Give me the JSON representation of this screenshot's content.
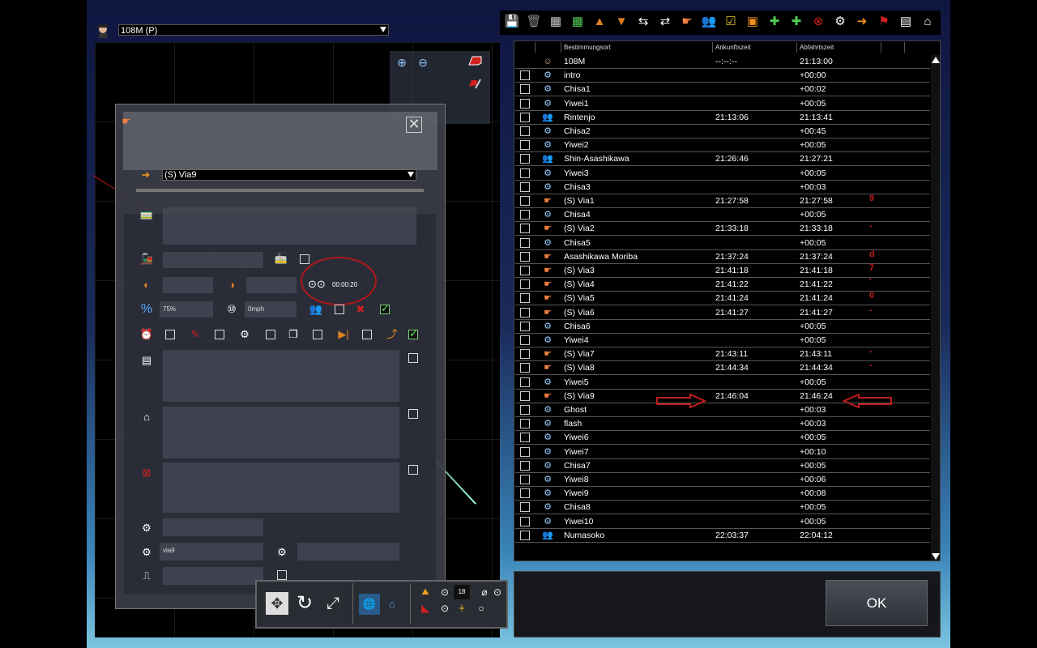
{
  "top": {
    "route_value": "108M (P)"
  },
  "panel": {
    "waypoint_value": "(S) Via9",
    "duration_value": "00:00:20",
    "percent_value": "75%",
    "speed_value": "0mph",
    "name_value": "via9"
  },
  "table": {
    "headers": {
      "destination": "Bestimmungsort",
      "arrival": "Ankunftszeit",
      "departure": "Abfahrtszeit"
    },
    "rows": [
      {
        "name": "108M",
        "arr": "--:--:--",
        "dep": "21:13:00",
        "icon": "driver",
        "cb": false,
        "mark": ""
      },
      {
        "name": "intro",
        "arr": "",
        "dep": "+00:00",
        "icon": "gear",
        "cb": true,
        "mark": ""
      },
      {
        "name": "Chisa1",
        "arr": "",
        "dep": "+00:02",
        "icon": "gear",
        "cb": true,
        "mark": ""
      },
      {
        "name": "Yiwei1",
        "arr": "",
        "dep": "+00:05",
        "icon": "gear",
        "cb": true,
        "mark": ""
      },
      {
        "name": "Rintenjo",
        "arr": "21:13:06",
        "dep": "21:13:41",
        "icon": "people",
        "cb": true,
        "mark": ""
      },
      {
        "name": "Chisa2",
        "arr": "",
        "dep": "+00:45",
        "icon": "gear",
        "cb": true,
        "mark": ""
      },
      {
        "name": "Yiwei2",
        "arr": "",
        "dep": "+00:05",
        "icon": "gear",
        "cb": true,
        "mark": ""
      },
      {
        "name": "Shin-Asashikawa",
        "arr": "21:26:46",
        "dep": "21:27:21",
        "icon": "people",
        "cb": true,
        "mark": ""
      },
      {
        "name": "Yiwei3",
        "arr": "",
        "dep": "+00:05",
        "icon": "gear",
        "cb": true,
        "mark": ""
      },
      {
        "name": "Chisa3",
        "arr": "",
        "dep": "+00:03",
        "icon": "gear",
        "cb": true,
        "mark": ""
      },
      {
        "name": "(S) Via1",
        "arr": "21:27:58",
        "dep": "21:27:58",
        "icon": "hand",
        "cb": true,
        "mark": "9"
      },
      {
        "name": "Chisa4",
        "arr": "",
        "dep": "+00:05",
        "icon": "gear",
        "cb": true,
        "mark": ""
      },
      {
        "name": "(S) Via2",
        "arr": "21:33:18",
        "dep": "21:33:18",
        "icon": "hand",
        "cb": true,
        "mark": "-"
      },
      {
        "name": "Chisa5",
        "arr": "",
        "dep": "+00:05",
        "icon": "gear",
        "cb": true,
        "mark": ""
      },
      {
        "name": "Asashikawa Moriba",
        "arr": "21:37:24",
        "dep": "21:37:24",
        "icon": "hand",
        "cb": true,
        "mark": "d"
      },
      {
        "name": "(S) Via3",
        "arr": "21:41:18",
        "dep": "21:41:18",
        "icon": "hand",
        "cb": true,
        "mark": "7"
      },
      {
        "name": "(S) Via4",
        "arr": "21:41:22",
        "dep": "21:41:22",
        "icon": "hand",
        "cb": true,
        "mark": "'"
      },
      {
        "name": "(S) Via5",
        "arr": "21:41:24",
        "dep": "21:41:24",
        "icon": "hand",
        "cb": true,
        "mark": "0"
      },
      {
        "name": "(S) Via6",
        "arr": "21:41:27",
        "dep": "21:41:27",
        "icon": "hand",
        "cb": true,
        "mark": "-"
      },
      {
        "name": "Chisa6",
        "arr": "",
        "dep": "+00:05",
        "icon": "gear",
        "cb": true,
        "mark": ""
      },
      {
        "name": "Yiwei4",
        "arr": "",
        "dep": "+00:05",
        "icon": "gear",
        "cb": true,
        "mark": ""
      },
      {
        "name": "(S) Via7",
        "arr": "21:43:11",
        "dep": "21:43:11",
        "icon": "hand",
        "cb": true,
        "mark": "-"
      },
      {
        "name": "(S) Via8",
        "arr": "21:44:34",
        "dep": "21:44:34",
        "icon": "hand",
        "cb": true,
        "mark": "-"
      },
      {
        "name": "Yiwei5",
        "arr": "",
        "dep": "+00:05",
        "icon": "gear",
        "cb": true,
        "mark": ""
      },
      {
        "name": "(S) Via9",
        "arr": "21:46:04",
        "dep": "21:46:24",
        "icon": "hand",
        "cb": true,
        "mark": ""
      },
      {
        "name": "Ghost",
        "arr": "",
        "dep": "+00:03",
        "icon": "gear",
        "cb": true,
        "mark": ""
      },
      {
        "name": "flash",
        "arr": "",
        "dep": "+00:03",
        "icon": "gear",
        "cb": true,
        "mark": ""
      },
      {
        "name": "Yiwei6",
        "arr": "",
        "dep": "+00:05",
        "icon": "gear",
        "cb": true,
        "mark": ""
      },
      {
        "name": "Yiwei7",
        "arr": "",
        "dep": "+00:10",
        "icon": "gear",
        "cb": true,
        "mark": ""
      },
      {
        "name": "Chisa7",
        "arr": "",
        "dep": "+00:05",
        "icon": "gear",
        "cb": true,
        "mark": ""
      },
      {
        "name": "Yiwei8",
        "arr": "",
        "dep": "+00:06",
        "icon": "gear",
        "cb": true,
        "mark": ""
      },
      {
        "name": "Yiwei9",
        "arr": "",
        "dep": "+00:08",
        "icon": "gear",
        "cb": true,
        "mark": ""
      },
      {
        "name": "Chisa8",
        "arr": "",
        "dep": "+00:05",
        "icon": "gear",
        "cb": true,
        "mark": ""
      },
      {
        "name": "Yiwei10",
        "arr": "",
        "dep": "+00:05",
        "icon": "gear",
        "cb": true,
        "mark": ""
      },
      {
        "name": "Numasoko",
        "arr": "22:03:37",
        "dep": "22:04:12",
        "icon": "people",
        "cb": true,
        "mark": ""
      }
    ]
  },
  "bottom": {
    "ok_label": "OK",
    "display_value": "18"
  },
  "colors": {
    "accent_red": "#c01c1c",
    "text": "#ffffff"
  }
}
